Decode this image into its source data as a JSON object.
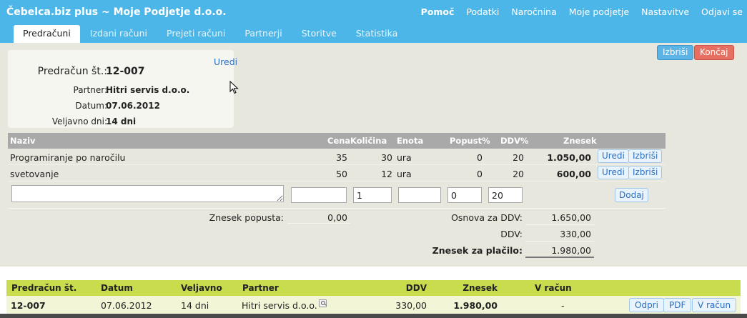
{
  "header": {
    "app_title": "Čebelca.biz plus ~ Moje Podjetje d.o.o.",
    "nav": [
      "Pomoč",
      "Podatki",
      "Naročnina",
      "Moje podjetje",
      "Nastavitve",
      "Odjavi se"
    ],
    "tabs": [
      "Predračuni",
      "Izdani računi",
      "Prejeti računi",
      "Partnerji",
      "Storitve",
      "Statistika"
    ],
    "active_tab": "Predračuni"
  },
  "actions": {
    "delete": "Izbriši",
    "finish": "Končaj"
  },
  "document": {
    "number_label": "Predračun št.:",
    "number": "12-007",
    "edit": "Uredi",
    "partner_label": "Partner:",
    "partner": "Hitri servis d.o.o.",
    "date_label": "Datum:",
    "date": "07.06.2012",
    "valid_label": "Veljavno dni:",
    "valid": "14 dni"
  },
  "items": {
    "columns": [
      "Naziv",
      "Cena",
      "Količina",
      "Enota",
      "Popust%",
      "DDV%",
      "Znesek"
    ],
    "rows": [
      {
        "naziv": "Programiranje po naročilu",
        "cena": "35",
        "kolicina": "30",
        "enota": "ura",
        "popust": "0",
        "ddv": "20",
        "znesek": "1.050,00"
      },
      {
        "naziv": "svetovanje",
        "cena": "50",
        "kolicina": "12",
        "enota": "ura",
        "popust": "0",
        "ddv": "20",
        "znesek": "600,00"
      }
    ],
    "row_edit": "Uredi",
    "row_delete": "Izbriši",
    "new_row": {
      "naziv": "",
      "cena": "",
      "kolicina": "1",
      "enota": "",
      "popust": "0",
      "ddv": "20"
    },
    "add": "Dodaj"
  },
  "summary": {
    "discount_label": "Znesek popusta:",
    "discount": "0,00",
    "base_label": "Osnova za DDV:",
    "base": "1.650,00",
    "vat_label": "DDV:",
    "vat": "330,00",
    "total_label": "Znesek za plačilo:",
    "total": "1.980,00"
  },
  "list": {
    "columns": [
      "Predračun št.",
      "Datum",
      "Veljavno",
      "Partner",
      "DDV",
      "Znesek",
      "V račun"
    ],
    "row": {
      "number": "12-007",
      "date": "07.06.2012",
      "valid": "14 dni",
      "partner": "Hitri servis d.o.o.",
      "ddv": "330,00",
      "znesek": "1.980,00",
      "v_racun": "-"
    },
    "buttons": [
      "Odpri",
      "PDF",
      "V račun"
    ]
  }
}
